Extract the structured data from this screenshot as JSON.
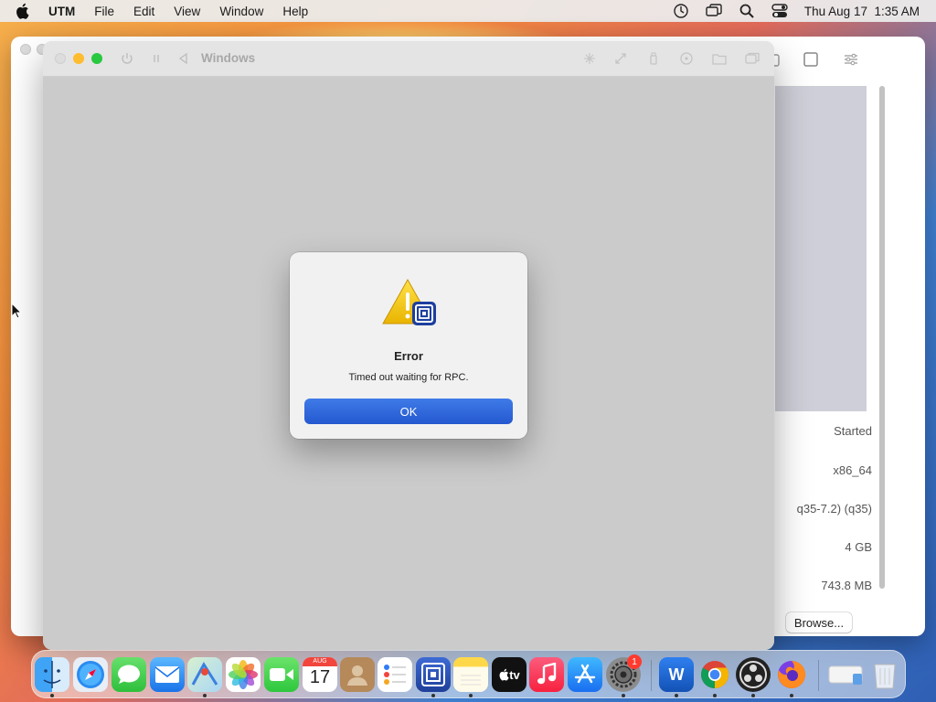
{
  "menubar": {
    "app_name": "UTM",
    "menus": [
      "File",
      "Edit",
      "View",
      "Window",
      "Help"
    ],
    "clock": "Thu Aug 17  1:35 AM"
  },
  "vm_window": {
    "title": "Windows"
  },
  "dialog": {
    "title": "Error",
    "message": "Timed out waiting for RPC.",
    "ok_label": "OK"
  },
  "details_panel": {
    "status": "Started",
    "architecture": "x86_64",
    "machine": "q35-7.2) (q35)",
    "memory": "4 GB",
    "size": "743.8 MB",
    "browse_label": "Browse..."
  },
  "dock": {
    "calendar_month": "AUG",
    "calendar_day": "17",
    "tv_label": "tv",
    "word_label": "W",
    "settings_badge": "1"
  },
  "colors": {
    "accent": "#2f66dd",
    "close": "#ff5f57",
    "minimize": "#febc2e",
    "maximize": "#28c840"
  }
}
